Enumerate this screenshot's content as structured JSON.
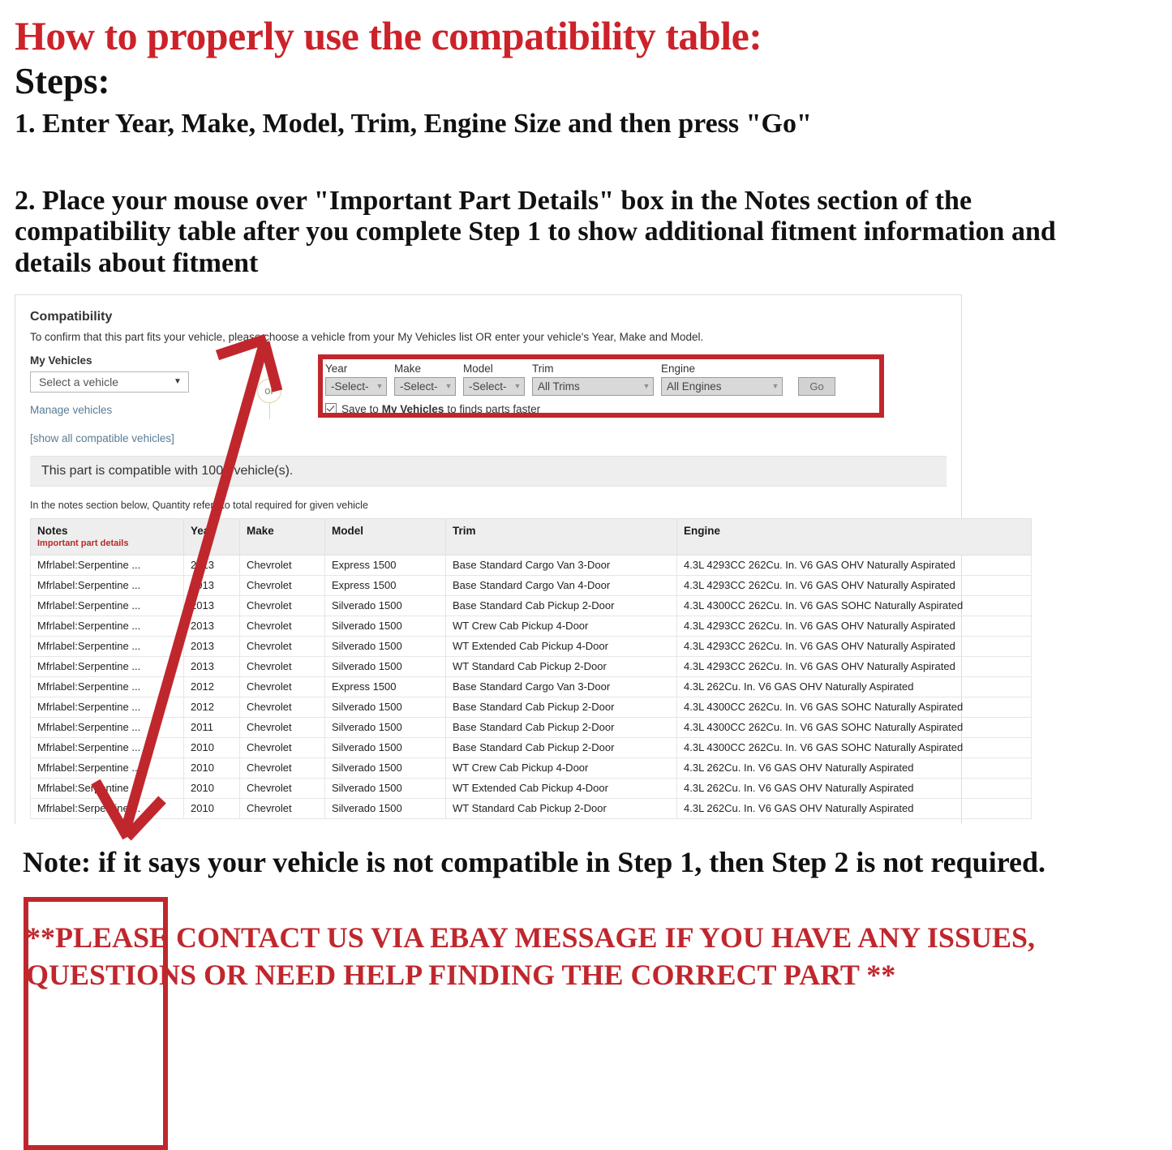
{
  "header": {
    "title": "How to properly use the compatibility table:",
    "steps_label": "Steps:",
    "step1": "1. Enter Year, Make, Model, Trim, Engine Size and then press \"Go\"",
    "step2": "2. Place your mouse over \"Important Part Details\" box in the Notes section of the compatibility table after you complete Step 1 to show additional fitment information and details about fitment"
  },
  "panel": {
    "title": "Compatibility",
    "subtitle": "To confirm that this part fits your vehicle, please choose a vehicle from your My Vehicles list OR enter your vehicle's Year, Make and Model.",
    "my_vehicles_label": "My Vehicles",
    "vehicle_select_value": "Select a vehicle",
    "manage_vehicles_link": "Manage vehicles",
    "or_text": "or",
    "show_all_link": "[show all compatible vehicles]",
    "compatible_banner": "This part is compatible with 1000 vehicle(s).",
    "notes_hint": "In the notes section below, Quantity refers to total required for given vehicle",
    "fields": [
      {
        "label": "Year",
        "value": "-Select-",
        "size": "small"
      },
      {
        "label": "Make",
        "value": "-Select-",
        "size": "small"
      },
      {
        "label": "Model",
        "value": "-Select-",
        "size": "small"
      },
      {
        "label": "Trim",
        "value": "All Trims",
        "size": "wide"
      },
      {
        "label": "Engine",
        "value": "All Engines",
        "size": "xwide"
      }
    ],
    "go_label": "Go",
    "save_prefix": "Save to",
    "save_bold": "My Vehicles",
    "save_suffix": "to finds parts faster"
  },
  "table": {
    "columns": [
      "Notes",
      "Year",
      "Make",
      "Model",
      "Trim",
      "Engine"
    ],
    "notes_subheader": "Important part details",
    "rows": [
      {
        "notes": "Mfrlabel:Serpentine ...",
        "year": "2013",
        "make": "Chevrolet",
        "model": "Express 1500",
        "trim": "Base Standard Cargo Van 3-Door",
        "engine": "4.3L 4293CC 262Cu. In. V6 GAS OHV Naturally Aspirated"
      },
      {
        "notes": "Mfrlabel:Serpentine ...",
        "year": "2013",
        "make": "Chevrolet",
        "model": "Express 1500",
        "trim": "Base Standard Cargo Van 4-Door",
        "engine": "4.3L 4293CC 262Cu. In. V6 GAS OHV Naturally Aspirated"
      },
      {
        "notes": "Mfrlabel:Serpentine ...",
        "year": "2013",
        "make": "Chevrolet",
        "model": "Silverado 1500",
        "trim": "Base Standard Cab Pickup 2-Door",
        "engine": "4.3L 4300CC 262Cu. In. V6 GAS SOHC Naturally Aspirated"
      },
      {
        "notes": "Mfrlabel:Serpentine ...",
        "year": "2013",
        "make": "Chevrolet",
        "model": "Silverado 1500",
        "trim": "WT Crew Cab Pickup 4-Door",
        "engine": "4.3L 4293CC 262Cu. In. V6 GAS OHV Naturally Aspirated"
      },
      {
        "notes": "Mfrlabel:Serpentine ...",
        "year": "2013",
        "make": "Chevrolet",
        "model": "Silverado 1500",
        "trim": "WT Extended Cab Pickup 4-Door",
        "engine": "4.3L 4293CC 262Cu. In. V6 GAS OHV Naturally Aspirated"
      },
      {
        "notes": "Mfrlabel:Serpentine ...",
        "year": "2013",
        "make": "Chevrolet",
        "model": "Silverado 1500",
        "trim": "WT Standard Cab Pickup 2-Door",
        "engine": "4.3L 4293CC 262Cu. In. V6 GAS OHV Naturally Aspirated"
      },
      {
        "notes": "Mfrlabel:Serpentine ...",
        "year": "2012",
        "make": "Chevrolet",
        "model": "Express 1500",
        "trim": "Base Standard Cargo Van 3-Door",
        "engine": "4.3L 262Cu. In. V6 GAS OHV Naturally Aspirated"
      },
      {
        "notes": "Mfrlabel:Serpentine ...",
        "year": "2012",
        "make": "Chevrolet",
        "model": "Silverado 1500",
        "trim": "Base Standard Cab Pickup 2-Door",
        "engine": "4.3L 4300CC 262Cu. In. V6 GAS SOHC Naturally Aspirated"
      },
      {
        "notes": "Mfrlabel:Serpentine ...",
        "year": "2011",
        "make": "Chevrolet",
        "model": "Silverado 1500",
        "trim": "Base Standard Cab Pickup 2-Door",
        "engine": "4.3L 4300CC 262Cu. In. V6 GAS SOHC Naturally Aspirated"
      },
      {
        "notes": "Mfrlabel:Serpentine ...",
        "year": "2010",
        "make": "Chevrolet",
        "model": "Silverado 1500",
        "trim": "Base Standard Cab Pickup 2-Door",
        "engine": "4.3L 4300CC 262Cu. In. V6 GAS SOHC Naturally Aspirated"
      },
      {
        "notes": "Mfrlabel:Serpentine ...",
        "year": "2010",
        "make": "Chevrolet",
        "model": "Silverado 1500",
        "trim": "WT Crew Cab Pickup 4-Door",
        "engine": "4.3L 262Cu. In. V6 GAS OHV Naturally Aspirated"
      },
      {
        "notes": "Mfrlabel:Serpentine ...",
        "year": "2010",
        "make": "Chevrolet",
        "model": "Silverado 1500",
        "trim": "WT Extended Cab Pickup 4-Door",
        "engine": "4.3L 262Cu. In. V6 GAS OHV Naturally Aspirated"
      },
      {
        "notes": "Mfrlabel:Serpentine ...",
        "year": "2010",
        "make": "Chevrolet",
        "model": "Silverado 1500",
        "trim": "WT Standard Cab Pickup 2-Door",
        "engine": "4.3L 262Cu. In. V6 GAS OHV Naturally Aspirated"
      }
    ]
  },
  "footer": {
    "note": "Note: if it says your vehicle is not compatible in Step 1, then Step 2 is not required.",
    "contact": "**PLEASE CONTACT US VIA EBAY MESSAGE IF YOU HAVE ANY ISSUES, QUESTIONS OR NEED HELP FINDING THE CORRECT PART **"
  },
  "colors": {
    "title_red": "#cc2229",
    "annotation_red": "#c0272d",
    "link_blue": "#5a7b94",
    "header_gray": "#eeeeee"
  }
}
